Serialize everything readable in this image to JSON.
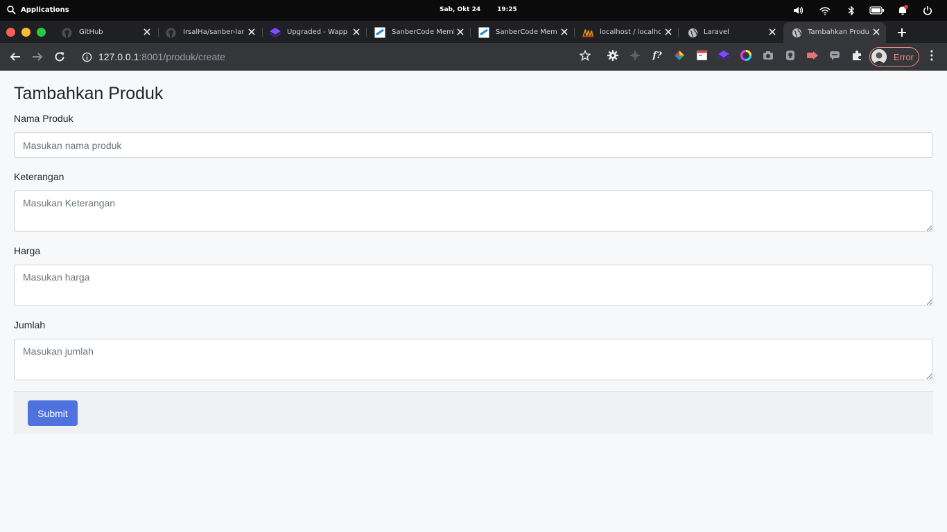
{
  "os": {
    "apps_label": "Applications",
    "date": "Sab, Okt 24",
    "time": "19:25"
  },
  "browser": {
    "tabs": [
      {
        "title": "GitHub",
        "icon": "github-icon"
      },
      {
        "title": "IrsalHa/sanber-larav",
        "icon": "github-icon"
      },
      {
        "title": "Upgraded - Wappaly",
        "icon": "wappalyzer-icon"
      },
      {
        "title": "SanberCode Membe",
        "icon": "sanbercode-icon"
      },
      {
        "title": "SanberCode Memb",
        "icon": "sanbercode-icon"
      },
      {
        "title": "localhost / localhost /",
        "icon": "phpmyadmin-icon"
      },
      {
        "title": "Laravel",
        "icon": "globe-icon"
      },
      {
        "title": "Tambahkan Produk",
        "icon": "globe-icon"
      }
    ],
    "active_tab": 7,
    "url_host": "127.0.0.1",
    "url_path": ":8001/produk/create",
    "profile_label": "Error"
  },
  "form": {
    "title": "Tambahkan Produk",
    "nama": {
      "label": "Nama Produk",
      "placeholder": "Masukan nama produk",
      "value": ""
    },
    "keterangan": {
      "label": "Keterangan",
      "placeholder": "Masukan Keterangan",
      "value": ""
    },
    "harga": {
      "label": "Harga",
      "placeholder": "Masukan harga",
      "value": ""
    },
    "jumlah": {
      "label": "Jumlah",
      "placeholder": "Masukan jumlah",
      "value": ""
    },
    "submit_label": "Submit"
  },
  "colors": {
    "primary": "#4e73df",
    "error": "#f28b82"
  }
}
